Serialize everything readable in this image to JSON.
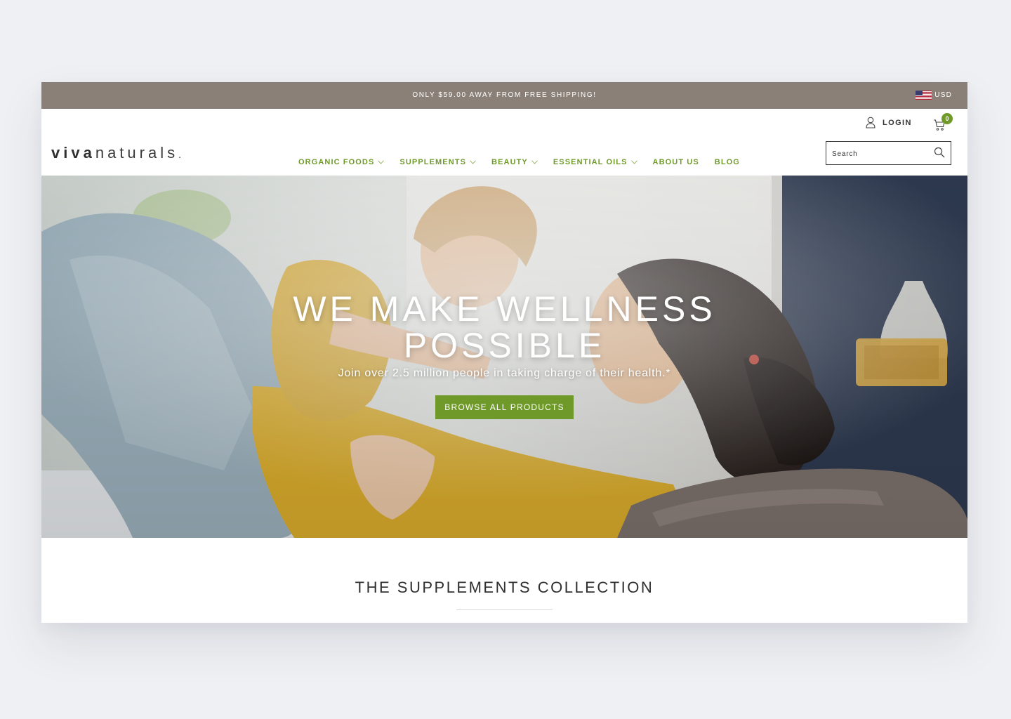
{
  "announcement": {
    "text": "ONLY $59.00 AWAY FROM FREE SHIPPING!"
  },
  "currency": {
    "label": "USD",
    "flag_icon": "us-flag-icon"
  },
  "header": {
    "login_label": "LOGIN",
    "cart_count": "0",
    "logo": {
      "bold": "viva",
      "light": "naturals",
      "dot": "."
    }
  },
  "nav": {
    "items": [
      {
        "label": "ORGANIC FOODS",
        "has_dropdown": true
      },
      {
        "label": "SUPPLEMENTS",
        "has_dropdown": true
      },
      {
        "label": "BEAUTY",
        "has_dropdown": true
      },
      {
        "label": "ESSENTIAL OILS",
        "has_dropdown": true
      },
      {
        "label": "ABOUT US",
        "has_dropdown": false
      },
      {
        "label": "BLOG",
        "has_dropdown": false
      }
    ]
  },
  "search": {
    "placeholder": "Search"
  },
  "hero": {
    "title_line1": "WE MAKE WELLNESS",
    "title_line2": "POSSIBLE",
    "subtitle": "Join over 2.5 million people in taking charge of their health.*",
    "button_label": "BROWSE ALL PRODUCTS"
  },
  "collection": {
    "title": "THE SUPPLEMENTS COLLECTION"
  },
  "colors": {
    "accent_green": "#6f9a2a",
    "announcement_bg": "#8b8078",
    "page_bg": "#eff0f3",
    "text_dark": "#2f2f2f"
  }
}
